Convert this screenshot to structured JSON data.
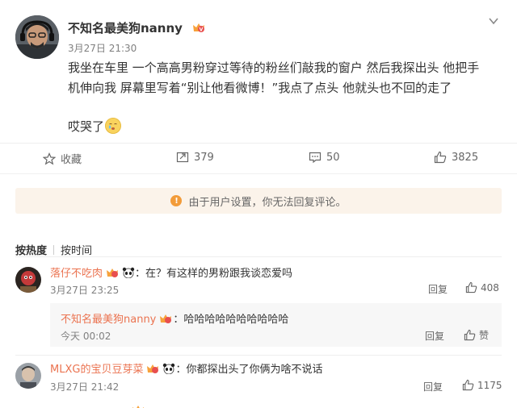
{
  "post": {
    "author": "不知名最美狗nanny",
    "time": "3月27日 21:30",
    "text": "我坐在车里 一个高高男粉穿过等待的粉丝们敲我的窗户 然后我探出头 他把手机伸向我 屏幕里写着“别让他看微博！”我点了点头 他就头也不回的走了",
    "text2": "哎哭了"
  },
  "actions": {
    "favorite": "收藏",
    "repost": "379",
    "comment": "50",
    "like": "3825"
  },
  "notice": "由于用户设置，你无法回复评论。",
  "sort": {
    "hot": "按热度",
    "time": "按时间"
  },
  "comments": [
    {
      "user": "落仔不吃肉",
      "text": "：在？有这样的男粉跟我谈恋爱吗",
      "time": "3月27日 23:25",
      "reply_label": "回复",
      "likes": "408",
      "subreply": {
        "user": "不知名最美狗nanny",
        "text": "：哈哈哈哈哈哈哈哈哈哈",
        "time": "今天 00:02",
        "reply_label": "回复",
        "like_label": "赞"
      }
    },
    {
      "user": "MLXG的宝贝豆芽菜",
      "text": "：你都探出头了你俩为啥不说话",
      "time": "3月27日 21:42",
      "reply_label": "回复",
      "likes": "1175"
    }
  ],
  "colors": {
    "username": "#eb7350",
    "notice_bg": "#fbf3ea",
    "warn": "#f29b39",
    "subreply_bg": "#f7f7f7"
  },
  "icons": [
    "chevron-down-icon",
    "star-icon",
    "repost-icon",
    "comment-icon",
    "thumbs-up-icon",
    "warning-icon",
    "vip-badge-icon",
    "panda-emoji-icon",
    "crying-emoji-icon"
  ]
}
